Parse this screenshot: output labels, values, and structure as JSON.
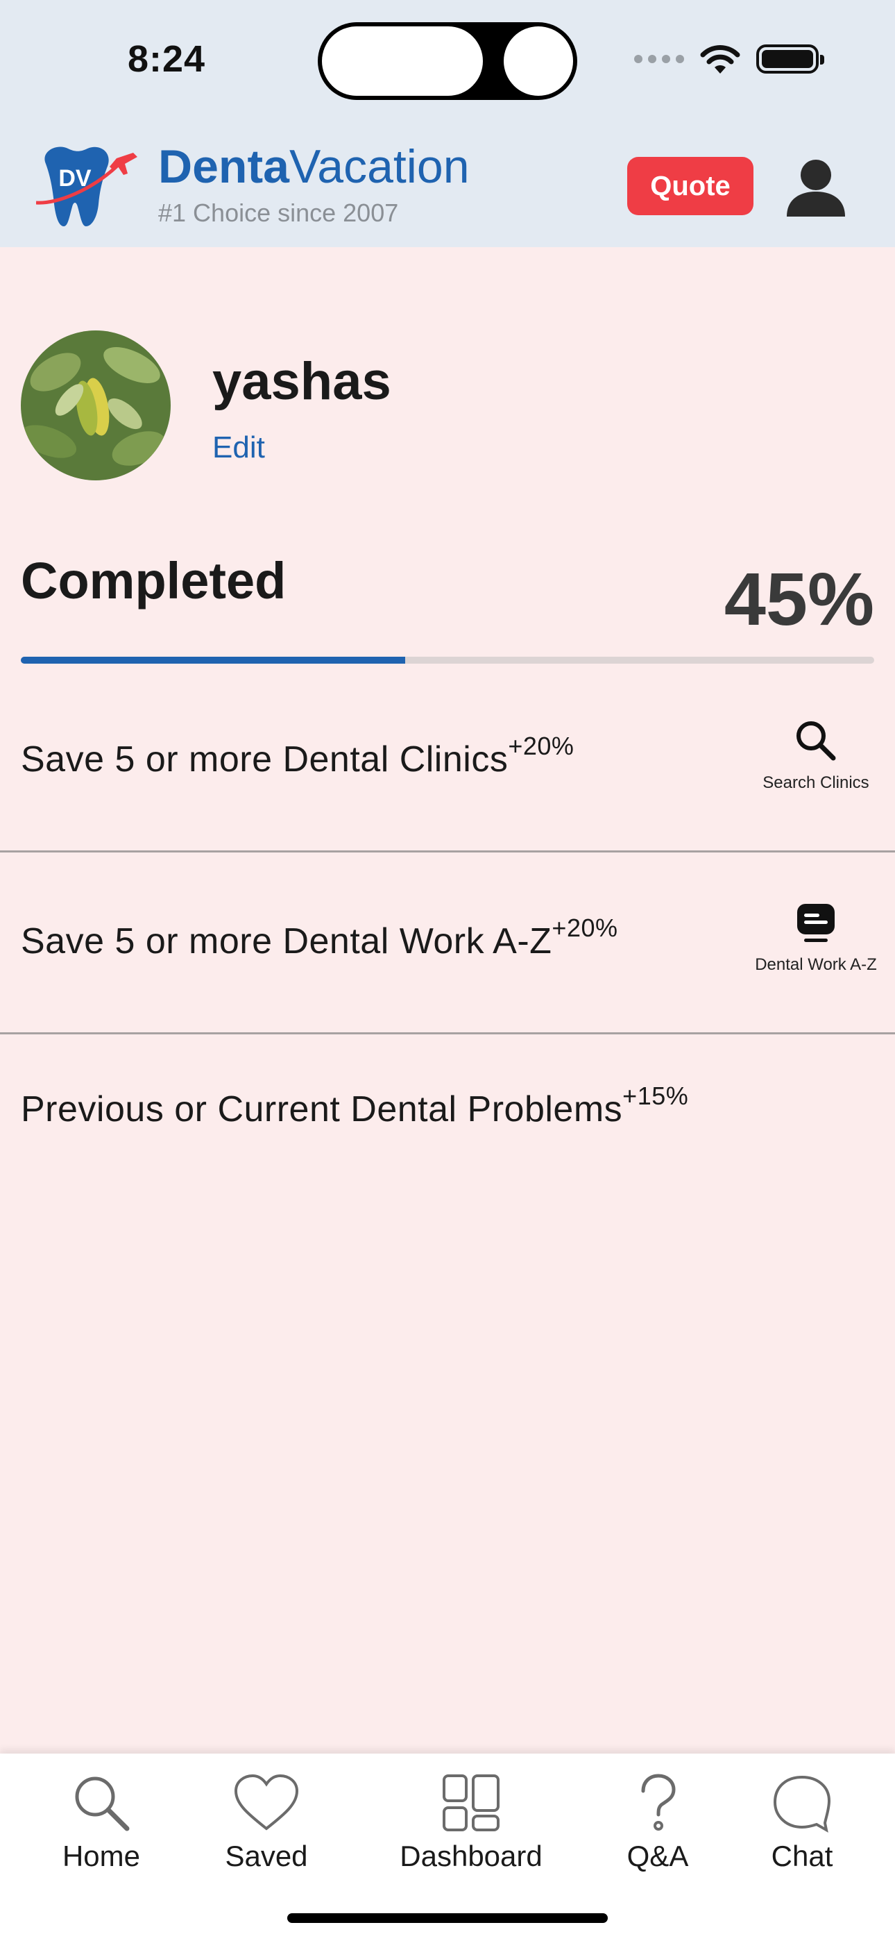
{
  "status_bar": {
    "time": "8:24"
  },
  "header": {
    "brand_bold": "Denta",
    "brand_light": "Vacation",
    "logo_text": "DV",
    "tagline": "#1 Choice since 2007",
    "quote_label": "Quote"
  },
  "profile": {
    "name": "yashas",
    "edit_label": "Edit"
  },
  "progress": {
    "label": "Completed",
    "percent_text": "45%",
    "value": 45
  },
  "tasks": [
    {
      "text": "Save 5 or more Dental Clinics",
      "bonus": "+20%",
      "action_label": "Search Clinics",
      "icon": "search-icon"
    },
    {
      "text": "Save 5 or more Dental Work A-Z",
      "bonus": "+20%",
      "action_label": "Dental Work A-Z",
      "icon": "list-card-icon"
    },
    {
      "text": "Previous or Current Dental Problems",
      "bonus": "+15%"
    }
  ],
  "tabbar": {
    "home": "Home",
    "saved": "Saved",
    "dashboard": "Dashboard",
    "qa": "Q&A",
    "chat": "Chat"
  },
  "colors": {
    "brand_blue": "#1f63b0",
    "quote_red": "#ef3d45",
    "header_bg": "#e3eaf2",
    "page_bg": "#fcecec"
  }
}
